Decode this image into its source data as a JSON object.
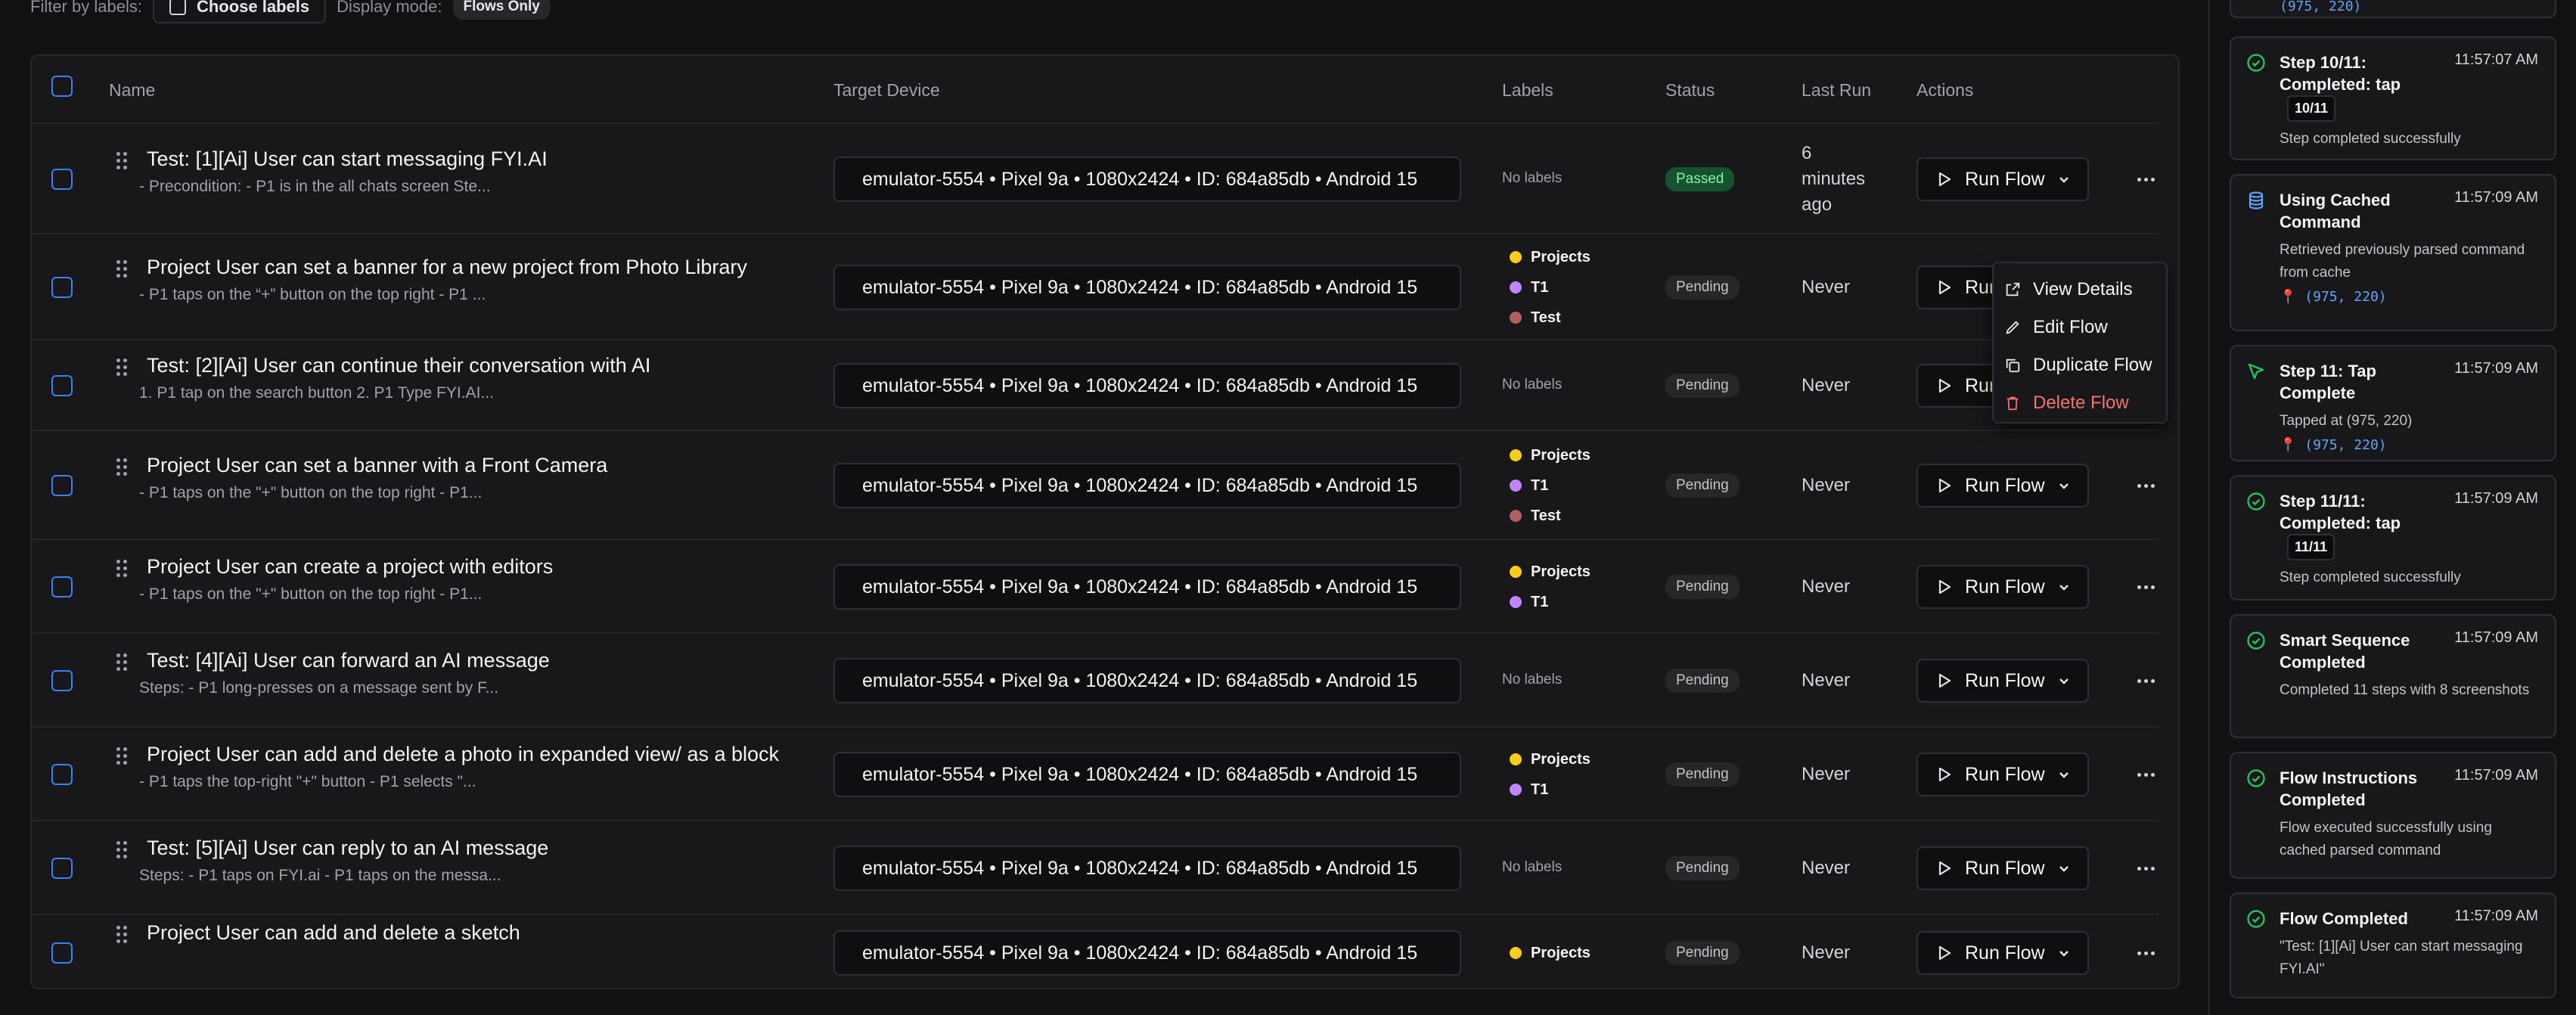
{
  "filter": {
    "label": "Filter by labels:",
    "choose_labels": "Choose labels",
    "display_mode_label": "Display mode:",
    "display_mode_value": "Flows Only"
  },
  "table": {
    "headers": {
      "name": "Name",
      "target_device": "Target Device",
      "labels": "Labels",
      "status": "Status",
      "last_run": "Last Run",
      "actions": "Actions"
    },
    "device_text": "emulator-5554 • Pixel 9a • 1080x2424 • ID: 684a85db • Android 15",
    "run_label": "Run Flow",
    "no_labels": "No labels",
    "rows": [
      {
        "title": "Test: [1][Ai] User can start messaging FYI.AI",
        "subtitle": "- Precondition: - P1 is in the all chats screen Ste...",
        "status": "Passed",
        "last_run": [
          "6",
          "minutes",
          "ago"
        ],
        "labels": []
      },
      {
        "title": "Project User can set a banner for a new project from Photo Library",
        "subtitle": "- P1 taps on the “+” button on the top right - P1 ...",
        "status": "Pending",
        "last_run": [
          "Never"
        ],
        "labels": [
          "Projects",
          "T1",
          "Test"
        ]
      },
      {
        "title": "Test: [2][Ai] User can continue their conversation with AI",
        "subtitle": "1. P1 tap on the search button 2. P1 Type FYI.AI...",
        "status": "Pending",
        "last_run": [
          "Never"
        ],
        "labels": []
      },
      {
        "title": "Project User can set a banner with a Front Camera",
        "subtitle": "- P1 taps on the \"+\" button on the top right - P1...",
        "status": "Pending",
        "last_run": [
          "Never"
        ],
        "labels": [
          "Projects",
          "T1",
          "Test"
        ]
      },
      {
        "title": "Project User can create a project with editors",
        "subtitle": "- P1 taps on the \"+\" button on the top right - P1...",
        "status": "Pending",
        "last_run": [
          "Never"
        ],
        "labels": [
          "Projects",
          "T1"
        ]
      },
      {
        "title": "Test: [4][Ai] User can forward an AI message",
        "subtitle": "Steps: - P1 long-presses on a message sent by F...",
        "status": "Pending",
        "last_run": [
          "Never"
        ],
        "labels": []
      },
      {
        "title": "Project User can add and delete a photo in expanded view/ as a block",
        "subtitle": "- P1 taps the top-right \"+\" button - P1 selects \"...",
        "status": "Pending",
        "last_run": [
          "Never"
        ],
        "labels": [
          "Projects",
          "T1"
        ]
      },
      {
        "title": "Test: [5][Ai] User can reply to an AI message",
        "subtitle": "Steps: - P1 taps on FYI.ai - P1 taps on the messa...",
        "status": "Pending",
        "last_run": [
          "Never"
        ],
        "labels": []
      },
      {
        "title": "Project User can add and delete a sketch",
        "subtitle": "",
        "status": "Pending",
        "last_run": [
          "Never"
        ],
        "labels": [
          "Projects"
        ]
      }
    ]
  },
  "label_colors": {
    "Projects": "#facc15",
    "T1": "#c084fc",
    "Test": "#b45f5f"
  },
  "menu": {
    "view": "View Details",
    "edit": "Edit Flow",
    "duplicate": "Duplicate Flow",
    "delete": "Delete Flow"
  },
  "events": {
    "top_partial_coord": "(975, 220)",
    "items": [
      {
        "title": "Step 10/11: Completed: tap",
        "badge": "10/11",
        "time": "11:57:07 AM",
        "desc": "Step completed successfully",
        "coord": "",
        "icon": "check-circle-icon"
      },
      {
        "title": "Using Cached Command",
        "badge": "",
        "time": "11:57:09 AM",
        "desc": "Retrieved previously parsed command from cache",
        "coord": "(975, 220)",
        "icon": "database-icon"
      },
      {
        "title": "Step 11: Tap Complete",
        "badge": "",
        "time": "11:57:09 AM",
        "desc": "Tapped at (975, 220)",
        "coord": "(975, 220)",
        "icon": "cursor-icon"
      },
      {
        "title": "Step 11/11: Completed: tap",
        "badge": "11/11",
        "time": "11:57:09 AM",
        "desc": "Step completed successfully",
        "coord": "",
        "icon": "check-circle-icon"
      },
      {
        "title": "Smart Sequence Completed",
        "badge": "",
        "time": "11:57:09 AM",
        "desc": "Completed 11 steps with 8 screenshots",
        "coord": "",
        "icon": "check-circle-icon"
      },
      {
        "title": "Flow Instructions Completed",
        "badge": "",
        "time": "11:57:09 AM",
        "desc": "Flow executed successfully using cached parsed command",
        "coord": "",
        "icon": "check-circle-icon"
      },
      {
        "title": "Flow Completed",
        "badge": "",
        "time": "11:57:09 AM",
        "desc": "\"Test: [1][Ai] User can start messaging FYI.AI\"",
        "coord": "",
        "icon": "check-circle-icon"
      }
    ]
  },
  "colors": {
    "accent_blue": "#3b82f6",
    "success_green": "#22c55e",
    "danger_red": "#f87171"
  }
}
